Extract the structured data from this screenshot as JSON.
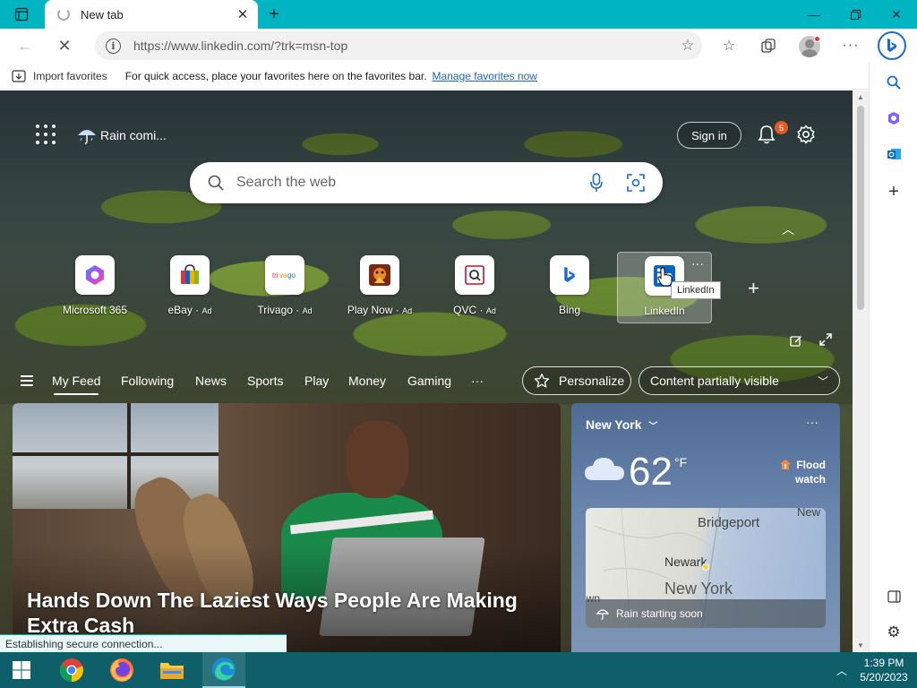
{
  "browser": {
    "tab_title": "New tab",
    "url": "https://www.linkedin.com/?trk=msn-top"
  },
  "favorites_bar": {
    "import_label": "Import favorites",
    "message": "For quick access, place your favorites here on the favorites bar.",
    "manage_link": "Manage favorites now"
  },
  "newtab": {
    "weather_text": "Rain comi...",
    "signin_label": "Sign in",
    "notification_count": "5",
    "search_placeholder": "Search the web",
    "tiles": [
      {
        "label": "Microsoft 365",
        "ad": ""
      },
      {
        "label": "eBay",
        "ad": "Ad"
      },
      {
        "label": "Trivago",
        "ad": "Ad"
      },
      {
        "label": "Play Now",
        "ad": "Ad"
      },
      {
        "label": "QVC",
        "ad": "Ad"
      },
      {
        "label": "Bing",
        "ad": ""
      },
      {
        "label": "LinkedIn",
        "ad": ""
      }
    ],
    "tooltip": "LinkedIn",
    "feed_tabs": [
      "My Feed",
      "Following",
      "News",
      "Sports",
      "Play",
      "Money",
      "Gaming",
      "···"
    ],
    "personalize_label": "Personalize",
    "content_visibility": "Content partially visible"
  },
  "hero": {
    "headline": "Hands Down The Laziest Ways People Are Making Extra Cash"
  },
  "weather_card": {
    "city": "New York",
    "temperature": "62",
    "unit": "°F",
    "alert_line1": "Flood",
    "alert_line2": "watch",
    "map_labels": {
      "bridgeport": "Bridgeport",
      "newark": "Newark",
      "new_york": "New York",
      "new_top": "New",
      "town": "own"
    },
    "rain_text": "Rain starting soon"
  },
  "status_text": "Establishing secure connection...",
  "clock": {
    "time": "1:39 PM",
    "date": "5/20/2023"
  },
  "colors": {
    "titlebar": "#00b4c2",
    "taskbar": "#0f5f6a",
    "link": "#1f64b6"
  }
}
